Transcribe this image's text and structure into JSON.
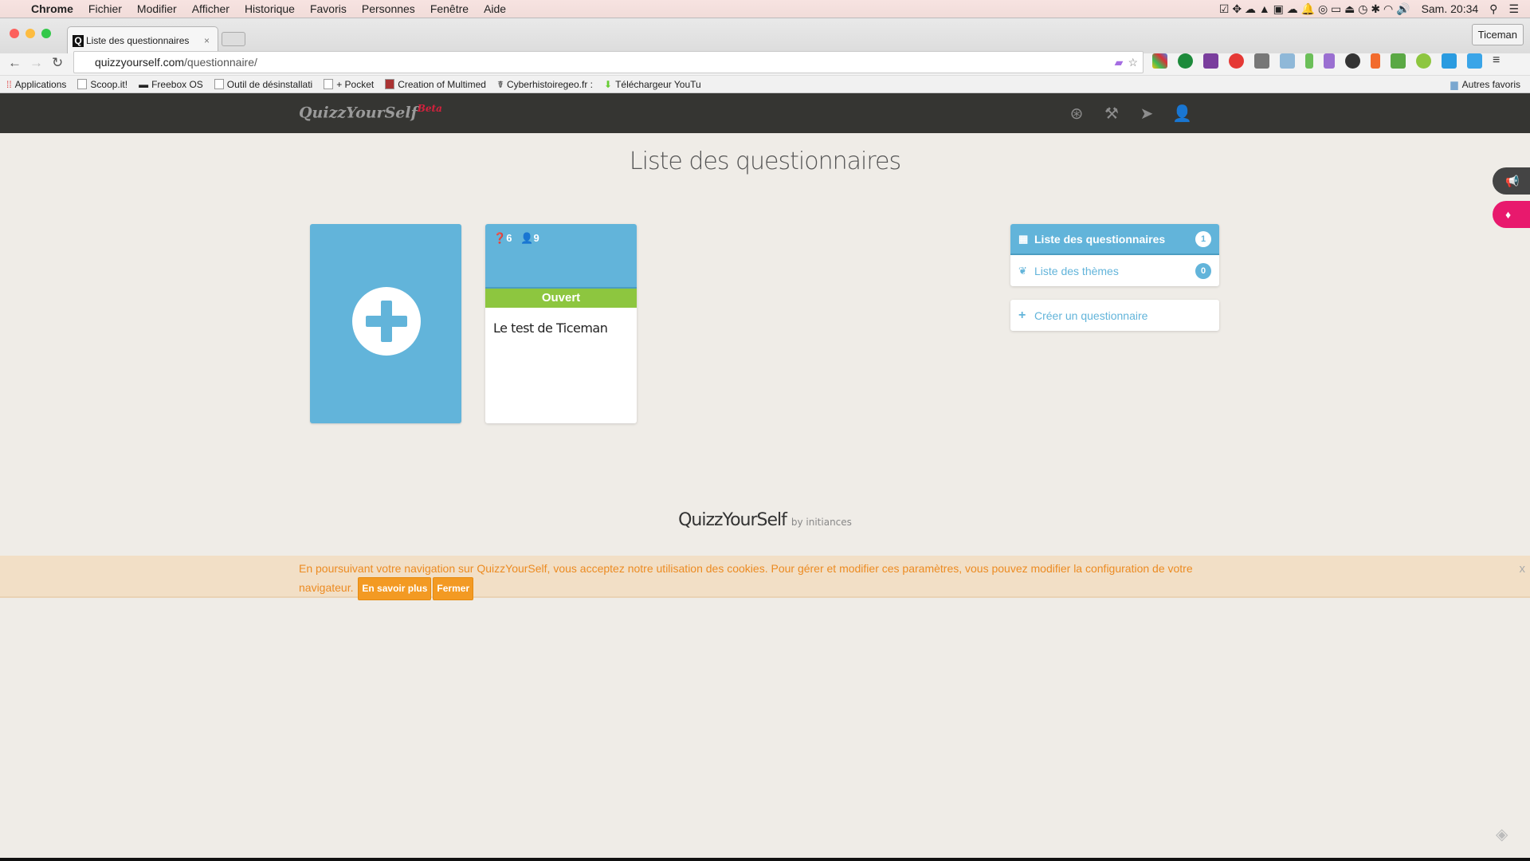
{
  "menubar": {
    "app": "Chrome",
    "items": [
      "Fichier",
      "Modifier",
      "Afficher",
      "Historique",
      "Favoris",
      "Personnes",
      "Fenêtre",
      "Aide"
    ],
    "clock": "Sam. 20:34"
  },
  "browser": {
    "tab_title": "Liste des questionnaires",
    "profile": "Ticeman",
    "url_host": "quizzyourself.com",
    "url_path": "/questionnaire/",
    "bookmarks": [
      "Applications",
      "Scoop.it!",
      "Freebox OS",
      "Outil de désinstallati",
      "+ Pocket",
      "Creation of Multimed",
      "Cyberhistoiregeo.fr :",
      "Téléchargeur YouTu"
    ],
    "other_bookmarks": "Autres favoris"
  },
  "app": {
    "logo": "QuizzYourSelf",
    "logo_tag": "Beta",
    "page_title": "Liste des questionnaires",
    "quiz": {
      "questions": "6",
      "participants": "9",
      "status": "Ouvert",
      "name": "Le test de Ticeman"
    },
    "sidebar": [
      {
        "label": "Liste des questionnaires",
        "count": "1"
      },
      {
        "label": "Liste des thèmes",
        "count": "0"
      }
    ],
    "create_label": "Créer un questionnaire",
    "footer_brand": "QuizzYourSelf",
    "footer_by": "by initiances",
    "cookie": {
      "text": "En poursuivant votre navigation sur QuizzYourSelf, vous acceptez notre utilisation des cookies. Pour gérer et modifier ces paramètres, vous pouvez modifier la configuration de votre navigateur.",
      "more": "En savoir plus",
      "close_label": "Fermer",
      "x": "x"
    }
  },
  "colors": {
    "primary": "#62b4da",
    "success": "#8dc63f",
    "navbar": "#353532",
    "cookie_text": "#ec8b22",
    "pink": "#e8196d"
  }
}
